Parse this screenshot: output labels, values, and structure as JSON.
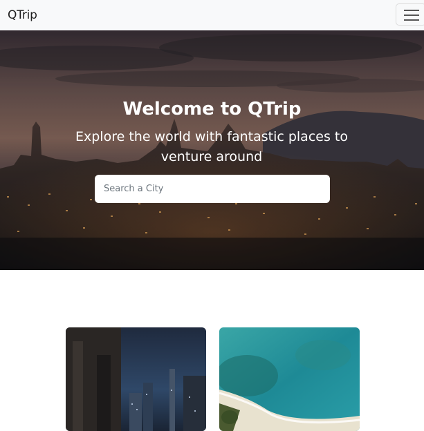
{
  "navbar": {
    "brand": "QTrip",
    "menu_icon": "hamburger-menu-icon"
  },
  "hero": {
    "title": "Welcome to QTrip",
    "subtitle": "Explore the world with fantastic places to venture around",
    "search": {
      "placeholder": "Search a City",
      "value": ""
    }
  },
  "cities": [
    {
      "image": "city-night-street-photo"
    },
    {
      "image": "aerial-beach-photo"
    }
  ],
  "colors": {
    "navbar_bg": "#f8f9fa",
    "hero_overlay": "#2a1f22",
    "text_white": "#ffffff"
  }
}
